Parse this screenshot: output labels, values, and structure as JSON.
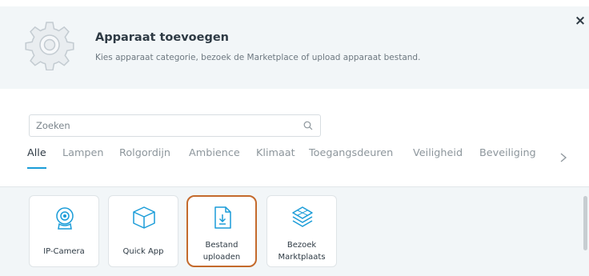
{
  "header": {
    "title": "Apparaat toevoegen",
    "subtitle": "Kies apparaat categorie, bezoek de Marketplace of upload apparaat bestand.",
    "icon": "gear-icon"
  },
  "close_label": "×",
  "search": {
    "placeholder": "Zoeken",
    "value": ""
  },
  "tabs": [
    {
      "label": "Alle",
      "active": true
    },
    {
      "label": "Lampen"
    },
    {
      "label": "Rolgordijn"
    },
    {
      "label": "Ambience"
    },
    {
      "label": "Klimaat"
    },
    {
      "label": "Toegangsdeuren"
    },
    {
      "label": "Veiligheid"
    },
    {
      "label": "Beveiliging"
    }
  ],
  "cards": [
    {
      "label": "IP-Camera",
      "icon": "ip-camera-icon"
    },
    {
      "label": "Quick App",
      "icon": "cube-icon"
    },
    {
      "label": "Bestand uploaden",
      "icon": "file-upload-icon",
      "selected": true
    },
    {
      "label": "Bezoek Marktplaats",
      "icon": "layers-icon"
    }
  ],
  "colors": {
    "accent": "#1a9cd8",
    "selected_border": "#c46a2c",
    "header_bg": "#f2f6f8",
    "text": "#2e3a44"
  }
}
